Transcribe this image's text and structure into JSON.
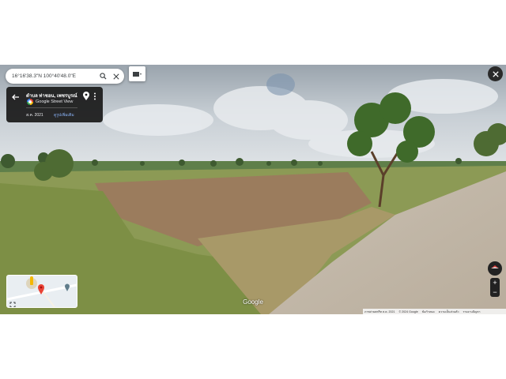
{
  "search": {
    "value": "16°16'38.3\"N 100°40'48.0\"E"
  },
  "info_card": {
    "place": "ตำบล ท่าชอน, เพชรบูรณ์",
    "source": "Google Street View",
    "date": "ส.ค. 2021",
    "see_more": "ดูรูปเพิ่มเติม"
  },
  "watermark": "Google",
  "footer": {
    "capture": "ภาพถ่ายสตรีท ส.ค. 2021",
    "copyright": "© 2024 Google",
    "terms": "ข้อกำหนด",
    "privacy": "ความเป็นส่วนตัว",
    "report": "รายงานปัญหา"
  },
  "zoom": {
    "in": "+",
    "out": "−"
  },
  "icons": {
    "back": "arrow-left-icon",
    "pin": "location-pin-icon",
    "more": "more-vert-icon",
    "search": "search-icon",
    "clear": "close-icon",
    "layers": "layers-icon",
    "close": "close-icon",
    "compass": "compass-icon",
    "expand": "expand-icon",
    "pegman": "pegman-icon",
    "map_pin": "red-map-pin-icon"
  },
  "colors": {
    "card_bg": "#191919",
    "link": "#8ab4f8",
    "pin": "#ea4335"
  }
}
